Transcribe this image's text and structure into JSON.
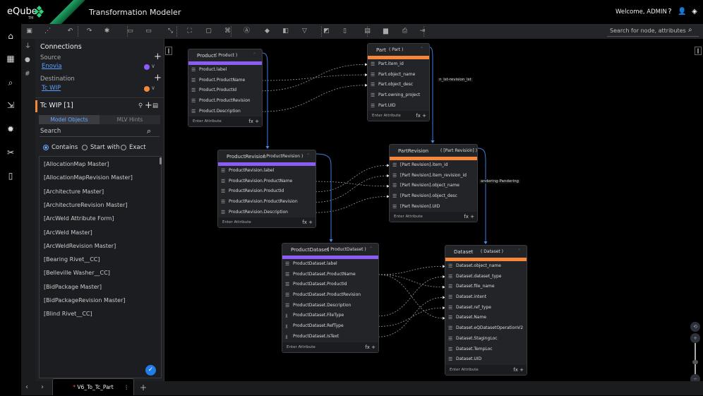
{
  "header": {
    "logo": "eQube",
    "logo_tm": "TM",
    "title": "Transformation Modeler",
    "welcome": "Welcome, ADMIN",
    "icons": [
      "help-icon",
      "user-icon",
      "logout-icon"
    ]
  },
  "toolbar": {
    "icons": [
      "save-icon",
      "layout-icon",
      "undo-icon",
      "redo-icon",
      "settings-icon",
      "mv1-icon",
      "mv2-icon",
      "collapse-icon",
      "fit-icon",
      "image-icon",
      "code-icon",
      "attribute-icon",
      "layers-icon",
      "panel-icon",
      "filter-icon",
      "note-icon",
      "document-icon",
      "database-icon",
      "folder-icon",
      "file-search-icon",
      "export-icon"
    ],
    "search_placeholder": "Search for node, attributes"
  },
  "rail": {
    "icons": [
      "home-icon",
      "dashboard-icon",
      "search-icon",
      "import-icon",
      "gear-icon",
      "tools-icon",
      "file-lock-icon"
    ]
  },
  "connections": {
    "title": "Connections",
    "source_label": "Source",
    "source_value": "Enovia",
    "source_color": "#8b5cf6",
    "destination_label": "Destination",
    "destination_value": "Tc WIP",
    "destination_color": "#f5873a"
  },
  "model_panel": {
    "title": "Tc WIP [1]",
    "tabs": [
      {
        "label": "Model Objects",
        "active": true
      },
      {
        "label": "MLV Hints",
        "active": false
      }
    ],
    "search_placeholder": "Search",
    "match_options": [
      {
        "label": "Contains",
        "selected": true
      },
      {
        "label": "Start with",
        "selected": false
      },
      {
        "label": "Exact",
        "selected": false
      }
    ],
    "items": [
      "[AllocationMap Master]",
      "[AllocationMapRevision Master]",
      "[Architecture Master]",
      "[ArchitectureRevision Master]",
      "[ArcWeld Attribute Form]",
      "[ArcWeld Master]",
      "[ArcWeldRevision Master]",
      "[Bearing Rivet__CC]",
      "[Belleville Washer__CC]",
      "[BidPackage Master]",
      "[BidPackageRevision Master]",
      "[Blind Rivet__CC]"
    ]
  },
  "canvas": {
    "enter_attribute": "Enter Attribute",
    "fx": "fx +",
    "nodes": [
      {
        "id": "product",
        "name": "Product",
        "alias": "( Product )",
        "color": "#8b5cf6",
        "rows": [
          "Product.label",
          "Product.ProductName",
          "Product.ProductId",
          "Product.ProductRevision",
          "Product.Description"
        ]
      },
      {
        "id": "part",
        "name": "Part",
        "alias": "( Part )",
        "color": "#f5873a",
        "rows": [
          "Part.item_id",
          "Part.object_name",
          "Part.object_desc",
          "Part.owning_project",
          "Part.UID"
        ]
      },
      {
        "id": "productrevision",
        "name": "ProductRevision",
        "alias": "( ProductRevision )",
        "color": "#8b5cf6",
        "rows": [
          "ProductRevision.label",
          "ProductRevision.ProductName",
          "ProductRevision.ProductId",
          "ProductRevision.ProductRevision",
          "ProductRevision.Description"
        ]
      },
      {
        "id": "partrevision",
        "name": "PartRevision",
        "alias": "( [Part Revision] )",
        "color": "#f5873a",
        "rows": [
          "[Part Revision].item_id",
          "[Part Revision].item_revision_id",
          "[Part Revision].object_name",
          "[Part Revision].object_desc",
          "[Part Revision].UID"
        ]
      },
      {
        "id": "productdataset",
        "name": "ProductDataset",
        "alias": "( ProductDataset )",
        "color": "#8b5cf6",
        "rows": [
          "ProductDataset.label",
          "ProductDataset.ProductName",
          "ProductDataset.ProductId",
          "ProductDataset.ProductRevision",
          "ProductDataset.Description",
          "ProductDataset.FileType",
          "ProductDataset.RefType",
          "ProductDataset.IsText"
        ]
      },
      {
        "id": "dataset",
        "name": "Dataset",
        "alias": "( Dataset )",
        "color": "#f5873a",
        "rows": [
          "Dataset.object_name",
          "Dataset.dataset_type",
          "Dataset.file_name",
          "Dataset.intent",
          "Dataset.ref_type",
          "Dataset.Name",
          "Dataset.eQDatasetOperationV2",
          "Dataset.StagingLoc",
          "Dataset.TempLoc",
          "Dataset.UID"
        ]
      }
    ],
    "edge_labels": [
      "n_lst-revision_lst",
      "andering-Pandering"
    ]
  },
  "bottom": {
    "doc_tab": "V6_To_Tc_Part",
    "modified_marker": "*"
  }
}
